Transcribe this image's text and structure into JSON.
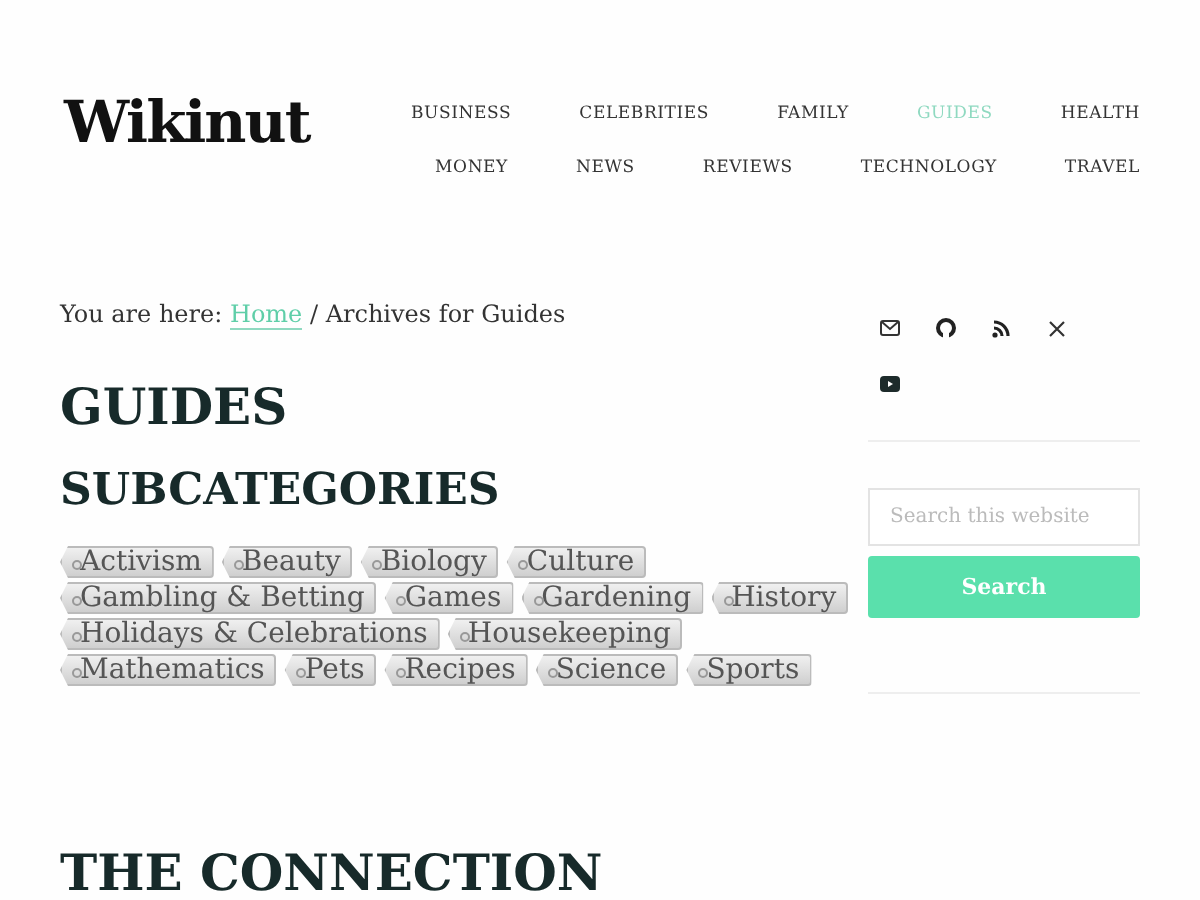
{
  "logo": "Wikinut",
  "nav": [
    {
      "label": "BUSINESS",
      "selected": false
    },
    {
      "label": "CELEBRITIES",
      "selected": false
    },
    {
      "label": "FAMILY",
      "selected": false
    },
    {
      "label": "GUIDES",
      "selected": true
    },
    {
      "label": "HEALTH",
      "selected": false
    },
    {
      "label": "MONEY",
      "selected": false
    },
    {
      "label": "NEWS",
      "selected": false
    },
    {
      "label": "REVIEWS",
      "selected": false
    },
    {
      "label": "TECHNOLOGY",
      "selected": false
    },
    {
      "label": "TRAVEL",
      "selected": false
    }
  ],
  "breadcrumb": {
    "prefix": "You are here:",
    "link": "Home",
    "rest": "/ Archives for Guides"
  },
  "title": "GUIDES",
  "subheading": "SUBCATEGORIES",
  "tags": [
    [
      "Activism",
      "Beauty",
      "Biology",
      "Culture"
    ],
    [
      "Gambling & Betting",
      "Games",
      "Gardening",
      "History"
    ],
    [
      "Holidays & Celebrations",
      "Housekeeping"
    ],
    [
      "Mathematics",
      "Pets",
      "Recipes",
      "Science",
      "Sports"
    ]
  ],
  "section_heading": "THE CONNECTION",
  "sidebar": {
    "social": [
      {
        "kind": "email"
      },
      {
        "kind": "github"
      },
      {
        "kind": "rss"
      },
      {
        "kind": "x"
      },
      {
        "kind": "youtube"
      }
    ],
    "search": {
      "placeholder": "Search this website",
      "button": "Search"
    }
  }
}
